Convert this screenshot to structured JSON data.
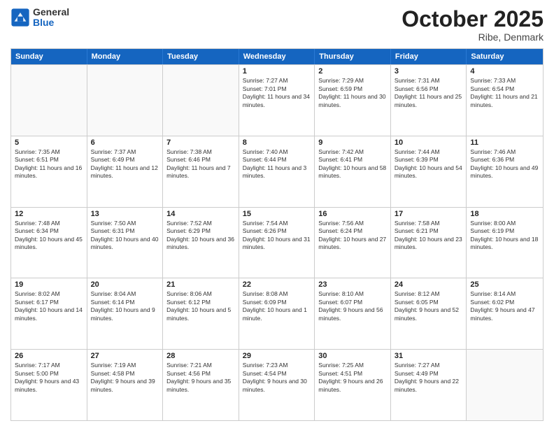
{
  "header": {
    "logo_general": "General",
    "logo_blue": "Blue",
    "month_title": "October 2025",
    "subtitle": "Ribe, Denmark"
  },
  "weekdays": [
    "Sunday",
    "Monday",
    "Tuesday",
    "Wednesday",
    "Thursday",
    "Friday",
    "Saturday"
  ],
  "rows": [
    [
      {
        "day": "",
        "empty": true
      },
      {
        "day": "",
        "empty": true
      },
      {
        "day": "",
        "empty": true
      },
      {
        "day": "1",
        "sunrise": "7:27 AM",
        "sunset": "7:01 PM",
        "daylight": "11 hours and 34 minutes."
      },
      {
        "day": "2",
        "sunrise": "7:29 AM",
        "sunset": "6:59 PM",
        "daylight": "11 hours and 30 minutes."
      },
      {
        "day": "3",
        "sunrise": "7:31 AM",
        "sunset": "6:56 PM",
        "daylight": "11 hours and 25 minutes."
      },
      {
        "day": "4",
        "sunrise": "7:33 AM",
        "sunset": "6:54 PM",
        "daylight": "11 hours and 21 minutes."
      }
    ],
    [
      {
        "day": "5",
        "sunrise": "7:35 AM",
        "sunset": "6:51 PM",
        "daylight": "11 hours and 16 minutes."
      },
      {
        "day": "6",
        "sunrise": "7:37 AM",
        "sunset": "6:49 PM",
        "daylight": "11 hours and 12 minutes."
      },
      {
        "day": "7",
        "sunrise": "7:38 AM",
        "sunset": "6:46 PM",
        "daylight": "11 hours and 7 minutes."
      },
      {
        "day": "8",
        "sunrise": "7:40 AM",
        "sunset": "6:44 PM",
        "daylight": "11 hours and 3 minutes."
      },
      {
        "day": "9",
        "sunrise": "7:42 AM",
        "sunset": "6:41 PM",
        "daylight": "10 hours and 58 minutes."
      },
      {
        "day": "10",
        "sunrise": "7:44 AM",
        "sunset": "6:39 PM",
        "daylight": "10 hours and 54 minutes."
      },
      {
        "day": "11",
        "sunrise": "7:46 AM",
        "sunset": "6:36 PM",
        "daylight": "10 hours and 49 minutes."
      }
    ],
    [
      {
        "day": "12",
        "sunrise": "7:48 AM",
        "sunset": "6:34 PM",
        "daylight": "10 hours and 45 minutes."
      },
      {
        "day": "13",
        "sunrise": "7:50 AM",
        "sunset": "6:31 PM",
        "daylight": "10 hours and 40 minutes."
      },
      {
        "day": "14",
        "sunrise": "7:52 AM",
        "sunset": "6:29 PM",
        "daylight": "10 hours and 36 minutes."
      },
      {
        "day": "15",
        "sunrise": "7:54 AM",
        "sunset": "6:26 PM",
        "daylight": "10 hours and 31 minutes."
      },
      {
        "day": "16",
        "sunrise": "7:56 AM",
        "sunset": "6:24 PM",
        "daylight": "10 hours and 27 minutes."
      },
      {
        "day": "17",
        "sunrise": "7:58 AM",
        "sunset": "6:21 PM",
        "daylight": "10 hours and 23 minutes."
      },
      {
        "day": "18",
        "sunrise": "8:00 AM",
        "sunset": "6:19 PM",
        "daylight": "10 hours and 18 minutes."
      }
    ],
    [
      {
        "day": "19",
        "sunrise": "8:02 AM",
        "sunset": "6:17 PM",
        "daylight": "10 hours and 14 minutes."
      },
      {
        "day": "20",
        "sunrise": "8:04 AM",
        "sunset": "6:14 PM",
        "daylight": "10 hours and 9 minutes."
      },
      {
        "day": "21",
        "sunrise": "8:06 AM",
        "sunset": "6:12 PM",
        "daylight": "10 hours and 5 minutes."
      },
      {
        "day": "22",
        "sunrise": "8:08 AM",
        "sunset": "6:09 PM",
        "daylight": "10 hours and 1 minute."
      },
      {
        "day": "23",
        "sunrise": "8:10 AM",
        "sunset": "6:07 PM",
        "daylight": "9 hours and 56 minutes."
      },
      {
        "day": "24",
        "sunrise": "8:12 AM",
        "sunset": "6:05 PM",
        "daylight": "9 hours and 52 minutes."
      },
      {
        "day": "25",
        "sunrise": "8:14 AM",
        "sunset": "6:02 PM",
        "daylight": "9 hours and 47 minutes."
      }
    ],
    [
      {
        "day": "26",
        "sunrise": "7:17 AM",
        "sunset": "5:00 PM",
        "daylight": "9 hours and 43 minutes."
      },
      {
        "day": "27",
        "sunrise": "7:19 AM",
        "sunset": "4:58 PM",
        "daylight": "9 hours and 39 minutes."
      },
      {
        "day": "28",
        "sunrise": "7:21 AM",
        "sunset": "4:56 PM",
        "daylight": "9 hours and 35 minutes."
      },
      {
        "day": "29",
        "sunrise": "7:23 AM",
        "sunset": "4:54 PM",
        "daylight": "9 hours and 30 minutes."
      },
      {
        "day": "30",
        "sunrise": "7:25 AM",
        "sunset": "4:51 PM",
        "daylight": "9 hours and 26 minutes."
      },
      {
        "day": "31",
        "sunrise": "7:27 AM",
        "sunset": "4:49 PM",
        "daylight": "9 hours and 22 minutes."
      },
      {
        "day": "",
        "empty": true
      }
    ]
  ]
}
